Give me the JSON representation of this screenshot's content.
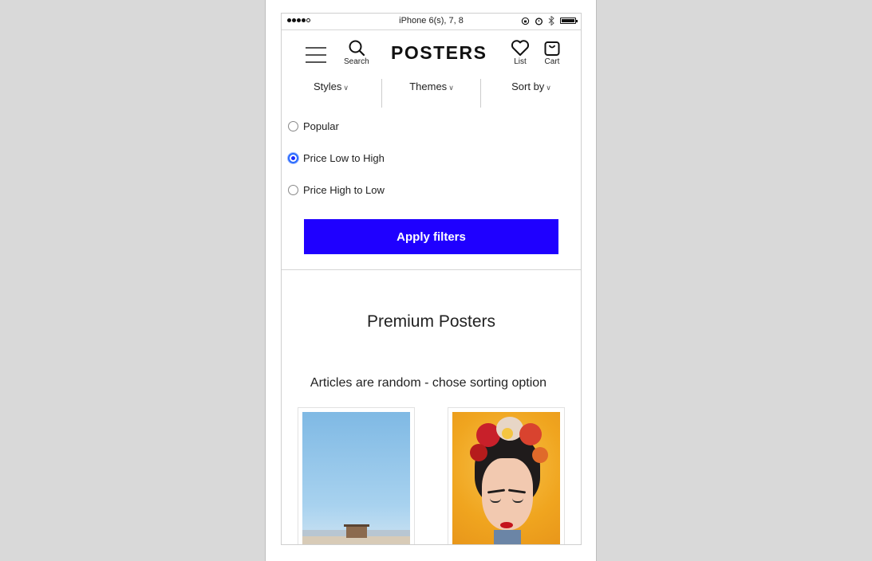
{
  "status_bar": {
    "device": "iPhone 6(s), 7, 8"
  },
  "header": {
    "logo": "POSTERS",
    "search_label": "Search",
    "list_label": "List",
    "cart_label": "Cart"
  },
  "filters": {
    "styles": "Styles",
    "themes": "Themes",
    "sort_by": "Sort by"
  },
  "sort_options": [
    {
      "label": "Popular",
      "selected": false
    },
    {
      "label": "Price Low to High",
      "selected": true
    },
    {
      "label": "Price High to Low",
      "selected": false
    }
  ],
  "apply_button": "Apply filters",
  "accent_color": "#1f00ff",
  "section_title": "Premium Posters",
  "note": "Articles are random - chose sorting option"
}
